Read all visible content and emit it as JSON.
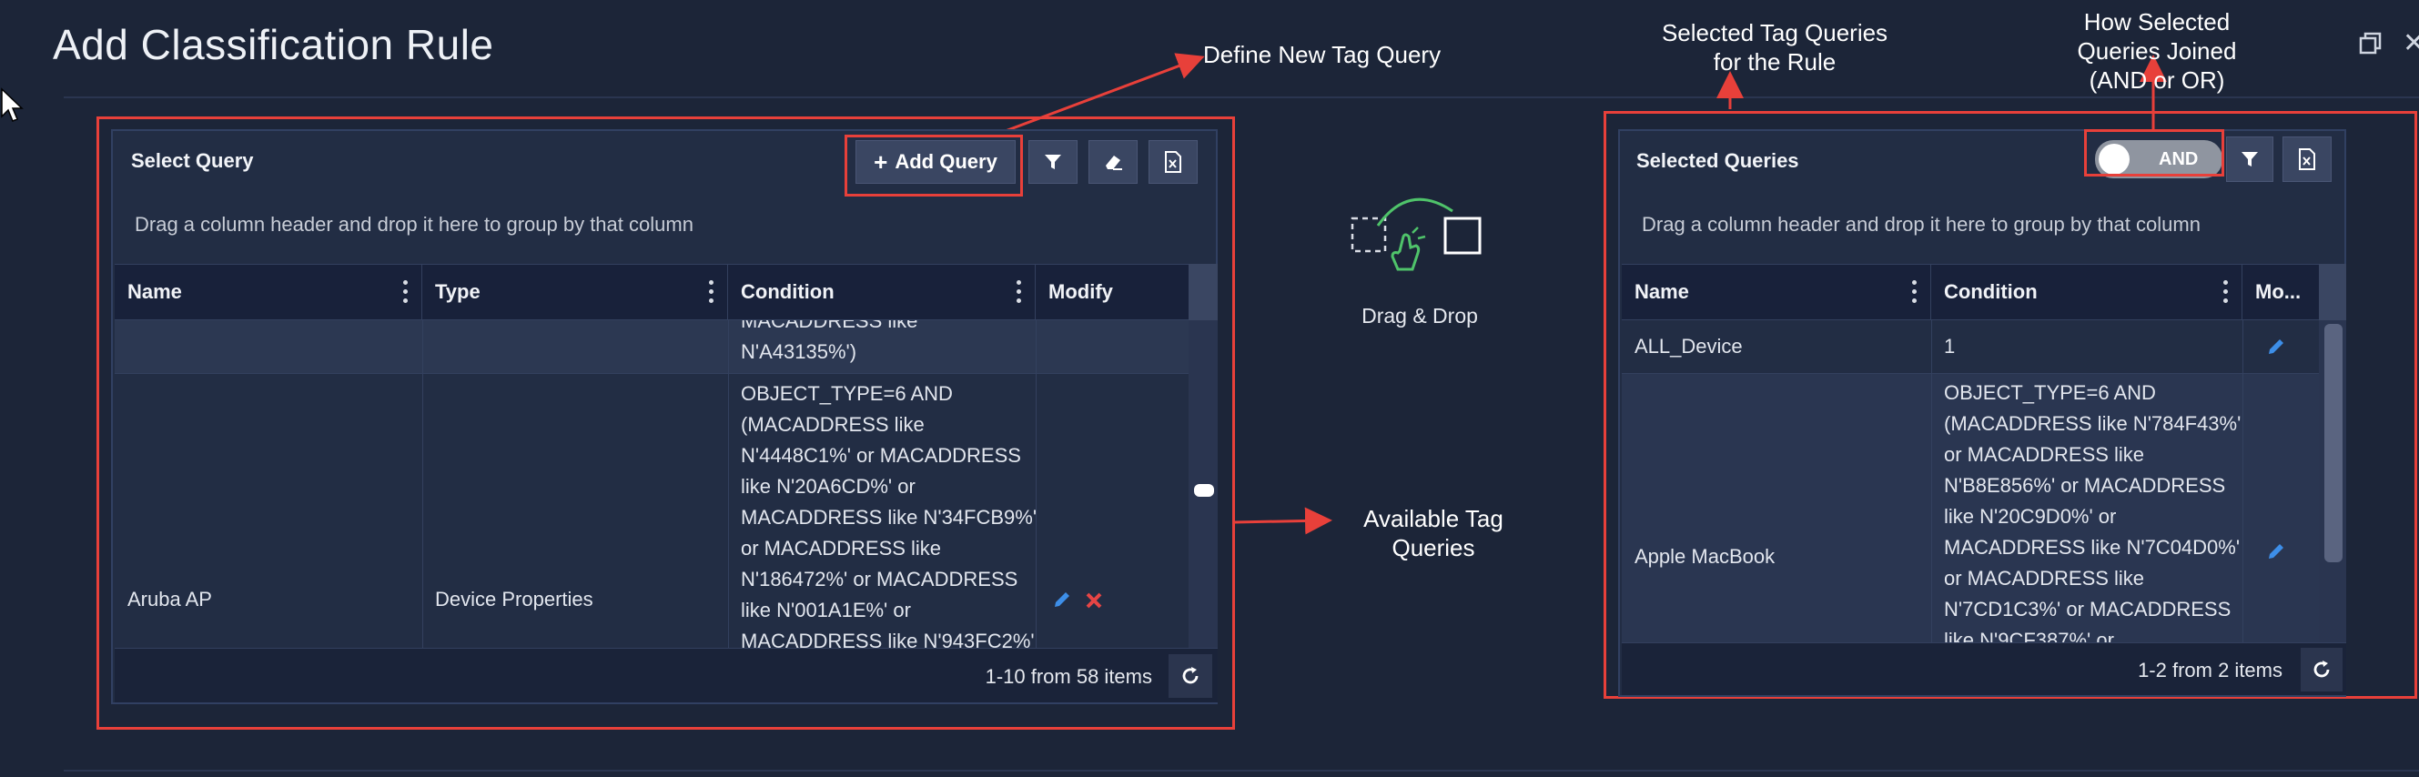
{
  "page": {
    "title": "Add Classification Rule"
  },
  "annotations": {
    "define_new": "Define New Tag Query",
    "available": [
      "Available Tag",
      "Queries"
    ],
    "selected_for_rule": [
      "Selected Tag Queries",
      "for the Rule"
    ],
    "how_joined": [
      "How Selected",
      "Queries Joined",
      "(AND or OR)"
    ]
  },
  "drag_drop": {
    "label": "Drag & Drop"
  },
  "select_query": {
    "title": "Select Query",
    "add_query_label": "Add Query",
    "group_hint": "Drag a column header and drop it here to group by that column",
    "columns": [
      "Name",
      "Type",
      "Condition",
      "Modify"
    ],
    "partial_row": {
      "condition_lines": [
        "MACADDRESS like",
        "N'A43135%')"
      ]
    },
    "row": {
      "name": "Aruba AP",
      "type": "Device Properties",
      "condition_lines": [
        "OBJECT_TYPE=6 AND",
        "(MACADDRESS like",
        "N'4448C1%' or MACADDRESS",
        "like N'20A6CD%' or",
        "MACADDRESS like N'34FCB9%'",
        "or MACADDRESS like",
        "N'186472%' or MACADDRESS",
        "like N'001A1E%' or",
        "MACADDRESS like N'943FC2%'"
      ]
    },
    "pager": "1-10 from 58 items"
  },
  "selected_queries": {
    "title": "Selected Queries",
    "toggle_label": "AND",
    "group_hint": "Drag a column header and drop it here to group by that column",
    "columns": [
      "Name",
      "Condition",
      "Mo..."
    ],
    "rows": [
      {
        "name": "ALL_Device",
        "condition_lines": [
          "1"
        ]
      },
      {
        "name": "Apple MacBook",
        "condition_lines": [
          "OBJECT_TYPE=6 AND",
          "(MACADDRESS like N'784F43%'",
          "or MACADDRESS like",
          "N'B8E856%' or MACADDRESS",
          "like N'20C9D0%' or",
          "MACADDRESS like N'7C04D0%'",
          "or MACADDRESS like",
          "N'7CD1C3%' or MACADDRESS",
          "like N'9CF387%' or"
        ]
      }
    ],
    "pager": "1-2 from 2 items"
  },
  "colors": {
    "accent_red": "#e8403a",
    "edit_blue": "#3d8ee8",
    "delete_red": "#e64545",
    "background": "#1c2538"
  }
}
